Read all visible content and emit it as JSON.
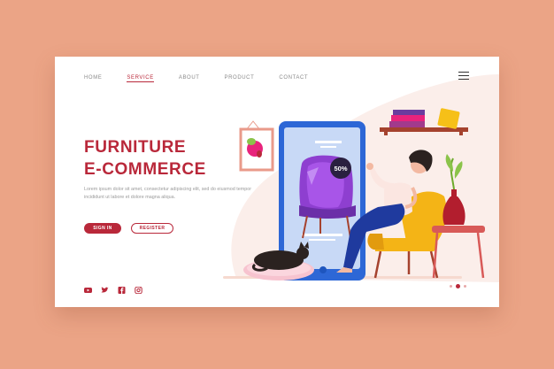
{
  "nav": {
    "items": [
      "HOME",
      "SERVICE",
      "ABOUT",
      "PRODUCT",
      "CONTACT"
    ],
    "active": "SERVICE"
  },
  "hero": {
    "title_line1": "FURNITURE",
    "title_line2": "E-COMMERCE",
    "body": "Lorem ipsum dolor sit amet, consectetur adipiscing elit, sed do eiusmod tempor incididunt ut labore et dolore magna aliqua.",
    "signin_label": "SIGN IN",
    "register_label": "REGISTER"
  },
  "phone": {
    "discount_label": "50%"
  },
  "social": [
    "youtube-icon",
    "twitter-icon",
    "facebook-icon",
    "instagram-icon"
  ],
  "carousel": {
    "count": 3,
    "active": 1
  },
  "colors": {
    "background": "#EBA486",
    "accent": "#B9283A",
    "card": "#FFFFFF"
  }
}
